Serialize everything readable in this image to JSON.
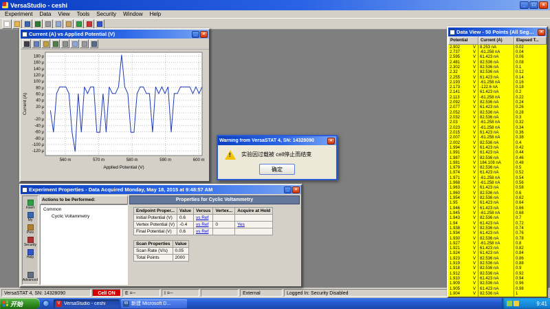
{
  "icons": {
    "minimize_glyph": "_",
    "maximize_glyph": "□",
    "close_glyph": "×",
    "warning_glyph": "!"
  },
  "app": {
    "title": "VersaStudio - ceshi",
    "menu": [
      "Experiment",
      "Data",
      "View",
      "Tools",
      "Security",
      "Window",
      "Help"
    ],
    "toolbar": [
      {
        "name": "new-icon",
        "color": "#ffffff"
      },
      {
        "name": "open-icon",
        "color": "#e8b64c"
      },
      {
        "name": "save-icon",
        "color": "#3a66b0"
      },
      {
        "name": "export-icon",
        "color": "#2f7d32"
      },
      {
        "name": "print-icon",
        "color": "#9a9aa2"
      },
      {
        "name": "copy-icon",
        "color": "#8fa8d8"
      },
      {
        "name": "paste-icon",
        "color": "#caa25e"
      },
      {
        "name": "run-icon",
        "color": "#2f9e44"
      },
      {
        "name": "stop-icon",
        "color": "#cc3333"
      },
      {
        "name": "help-icon",
        "color": "#3355cc"
      }
    ]
  },
  "statusbar": {
    "device": "VersaSTAT 4, SN: 14328090",
    "cell": "Cell ON",
    "e_reading": "E =--",
    "i_reading": "I =--",
    "mode": "External",
    "login": "Logged In: Security Disabled"
  },
  "chart_window": {
    "title": "Current (A) vs Applied Potential (V)",
    "toolbar": [
      {
        "name": "pointer-icon",
        "color": "#404048"
      },
      {
        "name": "zoom-icon",
        "color": "#6080c0"
      },
      {
        "name": "pan-icon",
        "color": "#c0a040"
      },
      {
        "name": "axes-icon",
        "color": "#508050"
      },
      {
        "name": "grid-icon",
        "color": "#909090"
      },
      {
        "name": "copy-chart-icon",
        "color": "#8fa8d8"
      },
      {
        "name": "print-chart-icon",
        "color": "#9a9aa2"
      },
      {
        "name": "chart-settings-icon",
        "color": "#5a6a8a"
      }
    ]
  },
  "chart_data": {
    "type": "line",
    "title": "Current (A) vs Applied Potential (V)",
    "xlabel": "Applied Potential (V)",
    "ylabel": "Current (A)",
    "x_unit": "m",
    "y_unit": "µ",
    "x_ticks": [
      560,
      570,
      580,
      590,
      600
    ],
    "y_ticks": [
      180,
      160,
      140,
      120,
      100,
      80,
      60,
      40,
      20,
      0,
      -20,
      -40,
      -60,
      -80,
      -100,
      -120
    ],
    "xlim": [
      554,
      601
    ],
    "ylim": [
      -135,
      192
    ],
    "x_start": 555.5,
    "x_end": 601,
    "grid": true,
    "legend": false,
    "series": [
      {
        "name": "Current",
        "values": [
          8.253,
          -61.258,
          61.423,
          82.536,
          82.536,
          82.536,
          61.423,
          -61.258,
          -122.6,
          61.423,
          -61.258,
          82.536,
          61.423,
          82.536,
          82.536,
          -61.258,
          -61.258,
          61.423,
          -61.258,
          82.536,
          61.423,
          61.423,
          82.536,
          184.108,
          82.536,
          61.423,
          -61.258,
          -61.258,
          61.423,
          82.536,
          82.536,
          61.423,
          61.423,
          -61.258,
          82.536,
          61.423,
          82.536,
          61.423,
          82.536,
          -61.258,
          61.423,
          61.423,
          82.536,
          82.536,
          82.536,
          82.536,
          61.423,
          82.536,
          61.423,
          82.536
        ]
      }
    ]
  },
  "warning_dialog": {
    "title": "Warning from VersaSTAT 4, SN: 14328090",
    "message": "实验因过载被 cell停止而结束",
    "ok_label": "确定"
  },
  "data_view": {
    "title": "Data View - 50 Points (All Segm...",
    "columns": [
      "Potential",
      "Current (A)",
      "Elapsed T..."
    ],
    "unit": "V",
    "rows": [
      [
        "2.902",
        "8.253 nA",
        "0.02"
      ],
      [
        "2.737",
        "-61.258 nA",
        "0.04"
      ],
      [
        "2.595",
        "61.423 nA",
        "0.06"
      ],
      [
        "2.481",
        "82.536 nA",
        "0.08"
      ],
      [
        "2.302",
        "82.536 nA",
        "0.1"
      ],
      [
        "2.32",
        "82.536 nA",
        "0.12"
      ],
      [
        "2.255",
        "61.423 nA",
        "0.14"
      ],
      [
        "2.193",
        "-61.258 nA",
        "0.16"
      ],
      [
        "2.173",
        "-122.6 nA",
        "0.18"
      ],
      [
        "2.141",
        "61.423 nA",
        "0.2"
      ],
      [
        "2.113",
        "-61.258 nA",
        "0.22"
      ],
      [
        "2.092",
        "82.536 nA",
        "0.24"
      ],
      [
        "2.077",
        "61.423 nA",
        "0.26"
      ],
      [
        "2.052",
        "82.536 nA",
        "0.28"
      ],
      [
        "2.032",
        "82.536 nA",
        "0.3"
      ],
      [
        "2.03",
        "-61.258 nA",
        "0.32"
      ],
      [
        "2.023",
        "-61.258 nA",
        "0.34"
      ],
      [
        "2.015",
        "61.423 nA",
        "0.36"
      ],
      [
        "2.007",
        "-61.258 nA",
        "0.38"
      ],
      [
        "2.002",
        "82.536 nA",
        "0.4"
      ],
      [
        "1.994",
        "61.423 nA",
        "0.42"
      ],
      [
        "1.991",
        "61.423 nA",
        "0.44"
      ],
      [
        "1.987",
        "82.536 nA",
        "0.46"
      ],
      [
        "1.981",
        "184.108 nA",
        "0.48"
      ],
      [
        "1.979",
        "82.536 nA",
        "0.5"
      ],
      [
        "1.974",
        "61.423 nA",
        "0.52"
      ],
      [
        "1.971",
        "-61.258 nA",
        "0.54"
      ],
      [
        "1.968",
        "-61.258 nA",
        "0.56"
      ],
      [
        "1.963",
        "61.423 nA",
        "0.58"
      ],
      [
        "1.960",
        "82.536 nA",
        "0.6"
      ],
      [
        "1.954",
        "82.536 nA",
        "0.62"
      ],
      [
        "1.95",
        "61.423 nA",
        "0.64"
      ],
      [
        "1.946",
        "61.423 nA",
        "0.66"
      ],
      [
        "1.945",
        "-61.258 nA",
        "0.68"
      ],
      [
        "1.943",
        "82.536 nA",
        "0.7"
      ],
      [
        "1.94",
        "61.423 nA",
        "0.72"
      ],
      [
        "1.938",
        "82.536 nA",
        "0.74"
      ],
      [
        "1.934",
        "61.423 nA",
        "0.76"
      ],
      [
        "1.930",
        "82.536 nA",
        "0.78"
      ],
      [
        "1.927",
        "-61.258 nA",
        "0.8"
      ],
      [
        "1.921",
        "61.423 nA",
        "0.82"
      ],
      [
        "1.924",
        "61.423 nA",
        "0.84"
      ],
      [
        "1.923",
        "82.536 nA",
        "0.86"
      ],
      [
        "1.919",
        "82.536 nA",
        "0.88"
      ],
      [
        "1.918",
        "82.536 nA",
        "0.9"
      ],
      [
        "1.912",
        "82.536 nA",
        "0.92"
      ],
      [
        "1.910",
        "61.423 nA",
        "0.94"
      ],
      [
        "1.909",
        "82.536 nA",
        "0.96"
      ],
      [
        "1.905",
        "61.423 nA",
        "0.98"
      ],
      [
        "1.904",
        "82.536 nA",
        "1"
      ]
    ]
  },
  "experiment_window": {
    "title": "Experiment Properties - Data Acquired Monday, May 18, 2015 at 9:48:57 AM",
    "sidebar": [
      {
        "label": "Insert",
        "name": "insert",
        "color": "#2f9e44"
      },
      {
        "label": "My",
        "name": "my",
        "color": "#3a66b0"
      },
      {
        "label": "Prev",
        "name": "prev",
        "color": "#b08030"
      },
      {
        "label": "Security",
        "name": "security",
        "color": "#b03030"
      },
      {
        "label": "Help",
        "name": "help",
        "color": "#3355cc"
      },
      {
        "label": "Advanced",
        "name": "advanced",
        "color": "#607080"
      }
    ],
    "actions_header": "Actions to be Performed:",
    "tree": {
      "root": "Common",
      "child": "Cyclic Voltammetry"
    },
    "properties_header": "Properties for Cyclic Voltammetry",
    "endpoint_table": {
      "headers": [
        "Endpoint Proper...",
        "Value",
        "Versus",
        "Vertex...",
        "Acquire at Hold"
      ],
      "rows": [
        [
          "Initial Potential (V)",
          "0.6",
          "vs Ref",
          "",
          ""
        ],
        [
          "Vertex Potential (V)",
          "-0.4",
          "vs Ref",
          "0",
          "Yes"
        ],
        [
          "Final Potential (V)",
          "0.6",
          "vs Ref",
          "",
          ""
        ]
      ]
    },
    "scan_table": {
      "headers": [
        "Scan Properties",
        "Value"
      ],
      "rows": [
        [
          "Scan Rate (V/s)",
          "0.05"
        ],
        [
          "Total Points",
          "2000"
        ]
      ]
    }
  },
  "taskbar": {
    "start_label": "开始",
    "tasks": [
      {
        "label": "VersaStudio - ceshi",
        "icon_glyph": "V",
        "icon_color": "#cc2222",
        "active": true
      },
      {
        "label": "新建 Microsoft D...",
        "icon_glyph": "W",
        "icon_color": "#2b579a",
        "active": false
      }
    ],
    "tray_time": "9:41"
  }
}
